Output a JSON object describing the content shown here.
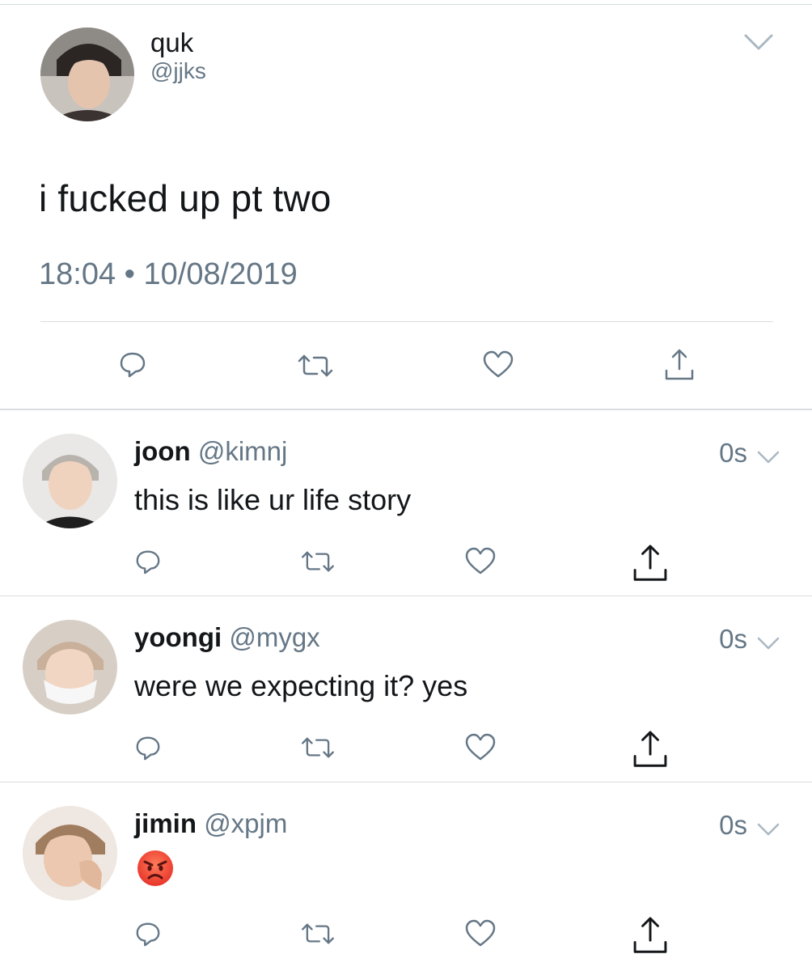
{
  "main_tweet": {
    "name": "quk",
    "handle": "@jjks",
    "text": "i fucked up pt two",
    "timestamp": "18:04 • 10/08/2019",
    "avatar": "avatar-photo",
    "actions": [
      "reply-icon",
      "retweet-icon",
      "like-icon",
      "share-icon"
    ]
  },
  "replies": [
    {
      "name": "joon",
      "handle": "@kimnj",
      "time": "0s",
      "text": "this is like ur life story"
    },
    {
      "name": "yoongi",
      "handle": "@mygx",
      "time": "0s",
      "text": "were we expecting it? yes"
    },
    {
      "name": "jimin",
      "handle": "@xpjm",
      "time": "0s",
      "text": "",
      "emoji": "angry-face-emoji"
    }
  ],
  "colors": {
    "text": "#14171a",
    "secondary": "#657786",
    "divider": "#d9dde0",
    "icon": "#657786"
  }
}
